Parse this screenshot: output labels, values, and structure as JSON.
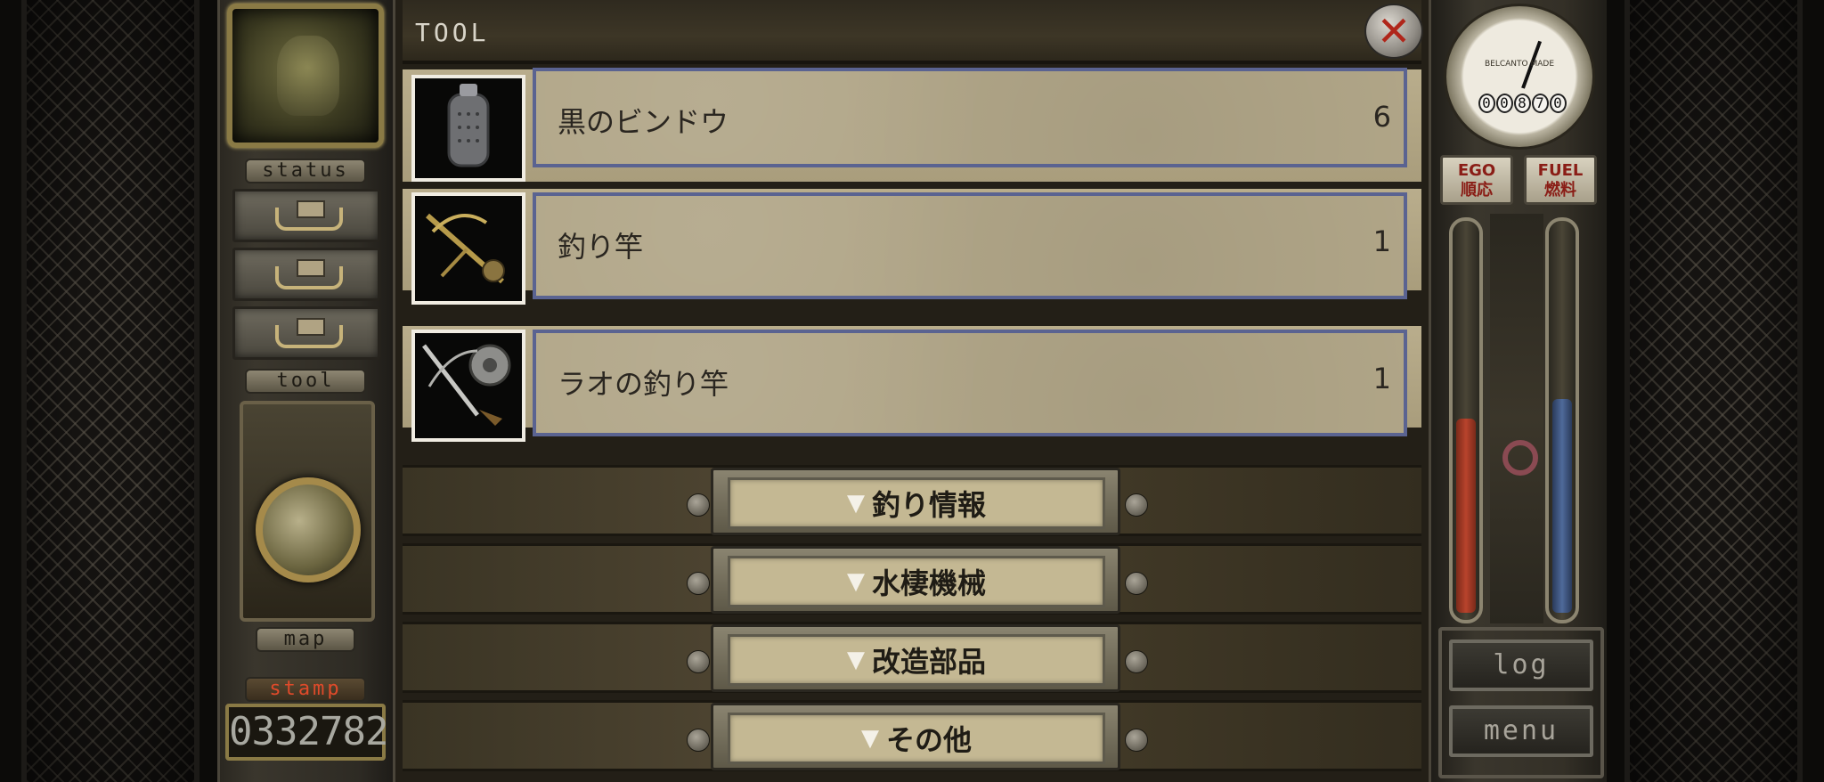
{
  "left": {
    "status_label": "STATUS",
    "tool_label": "TOOL",
    "map_label": "MAP",
    "stamp_label": "STAMP",
    "stamp_count": "0332782"
  },
  "window": {
    "title": "TOOL"
  },
  "items": [
    {
      "name": "黒のビンドウ",
      "qty": "6",
      "icon": "lantern-icon"
    },
    {
      "name": "釣り竿",
      "qty": "1",
      "icon": "fishing-rod-icon"
    },
    {
      "name": "ラオの釣り竿",
      "qty": "1",
      "icon": "reel-rod-icon"
    }
  ],
  "categories": [
    {
      "label": "釣り情報",
      "arrow": "▼"
    },
    {
      "label": "水棲機械",
      "arrow": "▼"
    },
    {
      "label": "改造部品",
      "arrow": "▼"
    },
    {
      "label": "その他",
      "arrow": "▼"
    }
  ],
  "right": {
    "gauge_brand": "BELCANTO MADE",
    "odometer": [
      "0",
      "0",
      "8",
      "7",
      "0"
    ],
    "ego_label_en": "EGO",
    "ego_label_jp": "順応",
    "fuel_label_en": "FUEL",
    "fuel_label_jp": "燃料",
    "ego_level": 0.5,
    "fuel_level": 0.55,
    "log_label": "LOG",
    "menu_label": "MENU"
  },
  "colors": {
    "card_border": "#5a6391",
    "ego_fill": "#b8432c",
    "fuel_fill": "#4f6a9a",
    "stamp_text": "#e04a2a"
  }
}
